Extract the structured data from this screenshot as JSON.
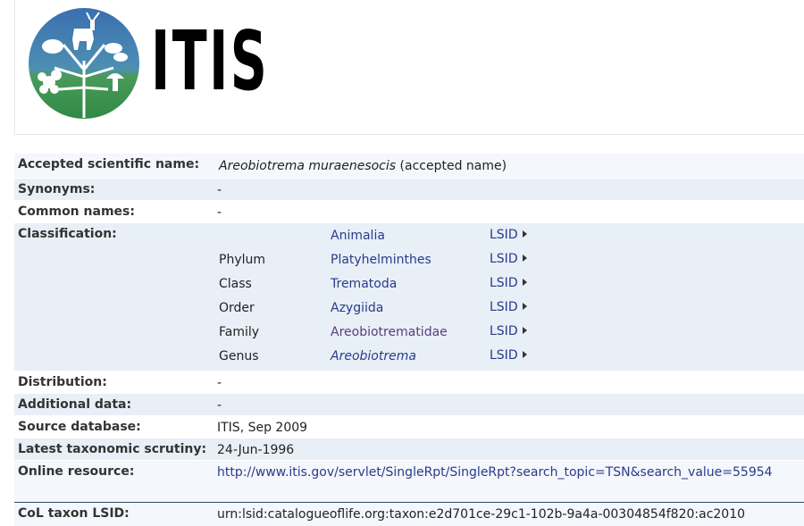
{
  "brand": {
    "name": "ITIS"
  },
  "rows": {
    "accepted": {
      "label": "Accepted scientific name:",
      "name": "Areobiotrema muraenesocis",
      "status": "(accepted name)"
    },
    "synonyms": {
      "label": "Synonyms:",
      "value": "-"
    },
    "common": {
      "label": "Common names:",
      "value": "-"
    },
    "classification": {
      "label": "Classification:",
      "lsid_label": "LSID",
      "items": [
        {
          "rank": "",
          "name": "Animalia"
        },
        {
          "rank": "Phylum",
          "name": "Platyhelminthes"
        },
        {
          "rank": "Class",
          "name": "Trematoda"
        },
        {
          "rank": "Order",
          "name": "Azygiida"
        },
        {
          "rank": "Family",
          "name": "Areobiotrematidae"
        },
        {
          "rank": "Genus",
          "name": "Areobiotrema"
        }
      ]
    },
    "distribution": {
      "label": "Distribution:",
      "value": "-"
    },
    "additional": {
      "label": "Additional data:",
      "value": "-"
    },
    "source": {
      "label": "Source database:",
      "value": "ITIS, Sep 2009"
    },
    "scrutiny": {
      "label": "Latest taxonomic scrutiny:",
      "value": "24-Jun-1996"
    },
    "online": {
      "label": "Online resource:",
      "value": "http://www.itis.gov/servlet/SingleRpt/SingleRpt?search_topic=TSN&search_value=55954"
    },
    "col_lsid": {
      "label": "CoL taxon LSID:",
      "value": "urn:lsid:catalogueoflife.org:taxon:e2d701ce-29c1-102b-9a4a-00304854f820:ac2010"
    }
  },
  "colors": {
    "link": "#2a3a8a",
    "row_blue": "#e8eff7",
    "row_light": "#f4f7fb"
  }
}
